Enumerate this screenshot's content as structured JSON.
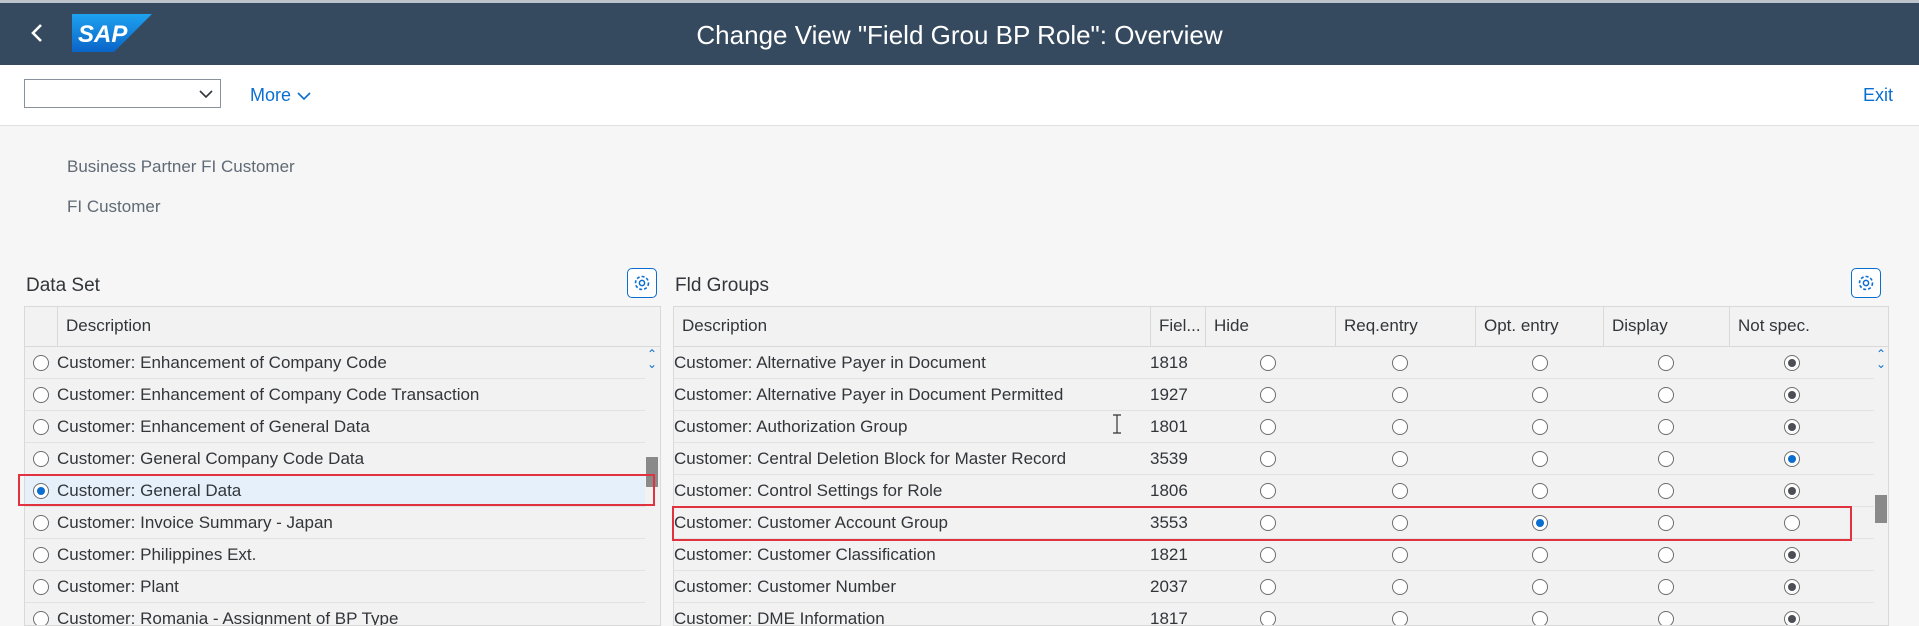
{
  "shell": {
    "title": "Change View \"Field Grou BP Role\": Overview",
    "logo_text": "SAP",
    "colors": {
      "header_bg": "#354a5f",
      "accent": "#0a6ed1",
      "highlight": "#e1333f"
    }
  },
  "toolbar": {
    "combo_value": "",
    "more_label": "More",
    "exit_label": "Exit"
  },
  "header": {
    "line1": "Business Partner FI Customer",
    "line2": "FI Customer"
  },
  "data_set": {
    "title": "Data Set",
    "column_header": "Description",
    "rows": [
      {
        "label": "Customer: Enhancement of Company Code",
        "selected": false
      },
      {
        "label": "Customer: Enhancement of Company Code Transaction",
        "selected": false
      },
      {
        "label": "Customer: Enhancement of General Data",
        "selected": false
      },
      {
        "label": "Customer: General Company Code Data",
        "selected": false
      },
      {
        "label": "Customer: General Data",
        "selected": true
      },
      {
        "label": "Customer: Invoice Summary - Japan",
        "selected": false
      },
      {
        "label": "Customer: Philippines Ext.",
        "selected": false
      },
      {
        "label": "Customer: Plant",
        "selected": false
      },
      {
        "label": "Customer: Romania - Assignment of BP Type",
        "selected": false
      }
    ]
  },
  "fld_groups": {
    "title": "Fld Groups",
    "headers": [
      "Description",
      "Fiel...",
      "Hide",
      "Req.entry",
      "Opt. entry",
      "Display",
      "Not spec."
    ],
    "rows": [
      {
        "desc": "Customer: Alternative Payer in Document",
        "num": "1818",
        "choice": "Not spec."
      },
      {
        "desc": "Customer: Alternative Payer in Document Permitted",
        "num": "1927",
        "choice": "Not spec."
      },
      {
        "desc": "Customer: Authorization Group",
        "num": "1801",
        "choice": "Not spec."
      },
      {
        "desc": "Customer: Central Deletion Block for Master Record",
        "num": "3539",
        "choice": "Not spec."
      },
      {
        "desc": "Customer: Control Settings for Role",
        "num": "1806",
        "choice": "Not spec."
      },
      {
        "desc": "Customer: Customer Account Group",
        "num": "3553",
        "choice": "Opt. entry"
      },
      {
        "desc": "Customer: Customer Classification",
        "num": "1821",
        "choice": "Not spec."
      },
      {
        "desc": "Customer: Customer Number",
        "num": "2037",
        "choice": "Not spec."
      },
      {
        "desc": "Customer: DME Information",
        "num": "1817",
        "choice": "Not spec."
      }
    ]
  }
}
